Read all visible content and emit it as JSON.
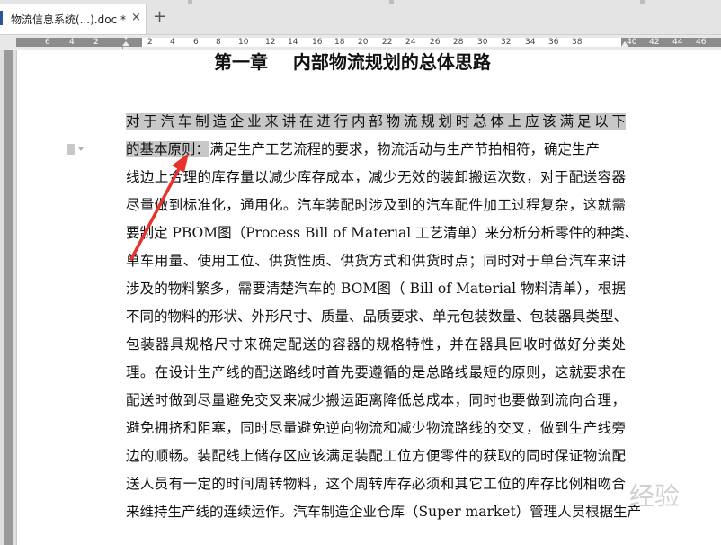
{
  "tab": {
    "title": "物流信息系统(...).doc *",
    "close_glyph": "×"
  },
  "new_tab_glyph": "+",
  "ruler": {
    "left_numbers": [
      "6",
      "4",
      "2",
      "2",
      "4",
      "6",
      "8",
      "10",
      "12",
      "14",
      "16",
      "18",
      "20",
      "22",
      "24",
      "26",
      "28",
      "30",
      "32",
      "34",
      "36",
      "38"
    ],
    "right_numbers": [
      "40",
      "42",
      "44",
      "46"
    ]
  },
  "document": {
    "chapter_title": "第一章    内部物流规划的总体思路",
    "selected_line_1": "对于汽车制造企业来讲在进行内部物流规划时总体上应该满足以下",
    "selected_line_2": "的基本原则：",
    "line_2_rest": "满足生产工艺流程的要求，物流活动与生产节拍相符，确定生产",
    "lines": [
      "线边上合理的库存量以减少库存成本，减少无效的装卸搬运次数，对于配送容器",
      "尽量做到标准化，通用化。汽车装配时涉及到的汽车配件加工过程复杂，这就需",
      "要制定 PBOM图（Process Bill of Material  工艺清单）来分析分析零件的种类、",
      "单车用量、使用工位、供货性质、供货方式和供货时点；同时对于单台汽车来讲",
      "涉及的物料繁多，需要清楚汽车的 BOM图（  Bill of Material  物料清单），根据",
      "不同的物料的形状、外形尺寸、质量、品质要求、单元包装数量、包装器具类型、",
      "包装器具规格尺寸来确定配送的容器的规格特性，并在器具回收时做好分类处",
      "理。在设计生产线的配送路线时首先要遵循的是总路线最短的原则，这就要求在",
      "配送时做到尽量避免交叉来减少搬运距离降低总成本，同时也要做到流向合理，",
      "避免拥挤和阻塞，同时尽量避免逆向物流和减少物流路线的交叉，做到生产线旁",
      "边的顺畅。装配线上储存区应该满足装配工位方便零件的获取的同时保证物流配",
      "送人员有一定的时间周转物料，这个周转库存必须和其它工位的库存比例相吻合",
      "来维持生产线的连续运作。汽车制造企业仓库（Super market）管理人员根据生产"
    ]
  },
  "watermark": "经验"
}
